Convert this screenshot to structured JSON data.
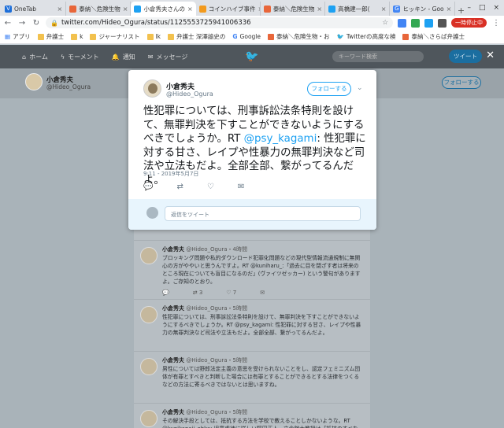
{
  "browser": {
    "tabs": [
      {
        "label": "OneTab",
        "color": "#1e6fd9"
      },
      {
        "label": "泰納＼危険生物",
        "color": "#e8663a"
      },
      {
        "label": "小倉秀夫さんの",
        "color": "#1da1f2"
      },
      {
        "label": "コインハイブ事件",
        "color": "#f29a1d"
      },
      {
        "label": "泰納＼危険生物",
        "color": "#e8663a"
      },
      {
        "label": "高橋建一郎(",
        "color": "#1da1f2"
      },
      {
        "label": "ヒッキン - Goo",
        "color": "#4285f4"
      }
    ],
    "new_tab": "+",
    "url": "twitter.com/Hideo_Ogura/status/1125553725941006336",
    "pause_label": "一時停止中",
    "bookmarks": [
      "アプリ",
      "弁護士",
      "k",
      "ジャーナリスト",
      "lk",
      "弁護士 深澤諭史の",
      "Google",
      "泰納＼危険生物・お",
      "Twitterの高度な検",
      "泰納＼さらば弁護士"
    ]
  },
  "twitter_nav": {
    "home": "ホーム",
    "moments": "モーメント",
    "notifications": "通知",
    "messages": "メッセージ",
    "search_placeholder": "キーワード検索",
    "tweet_button": "ツイート"
  },
  "profile": {
    "name": "小倉秀夫",
    "handle": "@Hideo_Ogura",
    "follow": "フォローする"
  },
  "modal": {
    "name": "小倉秀夫",
    "handle": "@Hideo_Ogura",
    "follow": "フォローする",
    "text_before": "性犯罪については、刑事訴訟法条特則を設けて、無罪判決を下すことができないようにするべきでしょうか。RT ",
    "mention": "@psy_kagami",
    "text_after": ": 性犯罪に対する甘さ、レイプや性暴力の無罪判決など司法や立法もだよ。全部全部、繋がってるんだよ。",
    "timestamp": "9:11 - 2019年5月7日",
    "reply_placeholder": "返信をツイート"
  },
  "timeline": [
    {
      "name": "小倉秀夫",
      "handle": "@Hideo_Ogura",
      "time": "・4時間",
      "text": "ブロッキング問題や私的ダウンロード犯罪化問題などの現代型情報流通規制に無関心の方がややいと思うんですよ。RT @kuniharu_:「過去に目を閉ざす者は将来のところ現在についても盲目になるのだ」(ヴァイツゼッカー) という警句がありますよ。ご存知のとおり。",
      "retweets": "3",
      "likes": "7"
    },
    {
      "name": "小倉秀夫",
      "handle": "@Hideo_Ogura",
      "time": "・5時間",
      "text": "性犯罪については、刑事訴訟法条特則を設けて、無罪判決を下すことができないようにするべきでしょうか。RT @psy_kagami: 性犯罪に対する甘さ、レイプや性暴力の無罪判決など司法や立法もだよ。全部全部、繋がってるんだよ。",
      "retweets": "",
      "likes": ""
    },
    {
      "name": "小倉秀夫",
      "handle": "@Hideo_Ogura",
      "time": "・5時間",
      "text": "男性については野郎法定主義の意思を受けられないことをし、認定フェミニズム団体が有罪とすべきと判断した場合には有罪とすることができるとする法律をつくるなどの方法に寄るべきではないとは思いますね。",
      "retweets": "",
      "likes": ""
    },
    {
      "name": "小倉秀夫",
      "handle": "@Hideo_Ogura",
      "time": "・5時間",
      "text": "その解決手段としては、抵抗する方法を学校で教えることしかないような。RT @kunikanaji_ohka: 児童虐待に詳しい野田正人・立命館大教授は「抵抗のすべを知",
      "retweets": "",
      "likes": ""
    }
  ]
}
